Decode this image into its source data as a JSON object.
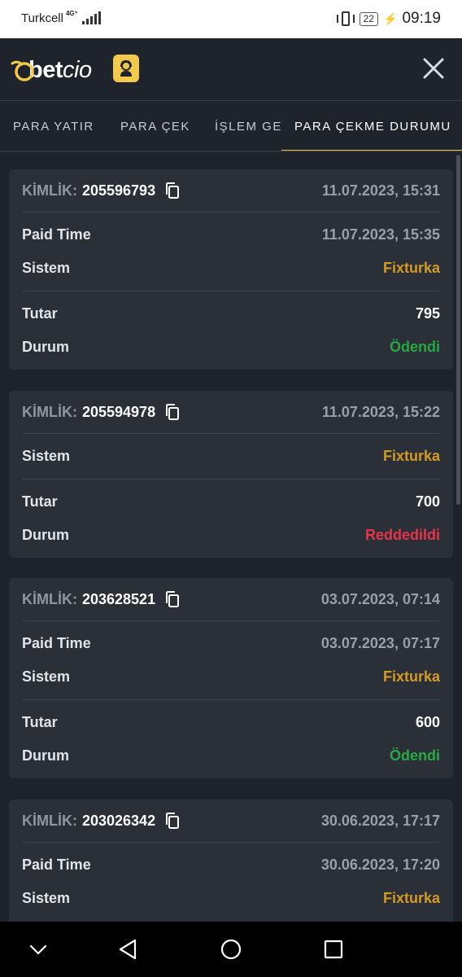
{
  "status_bar": {
    "carrier": "Turkcell",
    "network": "4G⁺",
    "battery": "22",
    "time": "09:19"
  },
  "header": {
    "logo_bold": "bet",
    "logo_italic": "cio",
    "brand_color": "#f2c94c"
  },
  "tabs": [
    {
      "label": "PARA YATIR"
    },
    {
      "label": "PARA ÇEK"
    },
    {
      "label": "İŞLEM GE"
    },
    {
      "label": "PARA ÇEKME DURUMU"
    }
  ],
  "cards": [
    {
      "id_label": "KİMLİK:",
      "id": "205596793",
      "date": "11.07.2023, 15:31",
      "paid_time_label": "Paid Time",
      "paid_time": "11.07.2023, 15:35",
      "system_label": "Sistem",
      "system": "Fixturka",
      "amount_label": "Tutar",
      "amount": "795",
      "status_label": "Durum",
      "status": "Ödendi"
    },
    {
      "id_label": "KİMLİK:",
      "id": "205594978",
      "date": "11.07.2023, 15:22",
      "system_label": "Sistem",
      "system": "Fixturka",
      "amount_label": "Tutar",
      "amount": "700",
      "status_label": "Durum",
      "status": "Reddedildi"
    },
    {
      "id_label": "KİMLİK:",
      "id": "203628521",
      "date": "03.07.2023, 07:14",
      "paid_time_label": "Paid Time",
      "paid_time": "03.07.2023, 07:17",
      "system_label": "Sistem",
      "system": "Fixturka",
      "amount_label": "Tutar",
      "amount": "600",
      "status_label": "Durum",
      "status": "Ödendi"
    },
    {
      "id_label": "KİMLİK:",
      "id": "203026342",
      "date": "30.06.2023, 17:17",
      "paid_time_label": "Paid Time",
      "paid_time": "30.06.2023, 17:20",
      "system_label": "Sistem",
      "system": "Fixturka"
    }
  ],
  "colors": {
    "paid": "#27a844",
    "rejected": "#e8344a",
    "system": "#d39b22"
  }
}
